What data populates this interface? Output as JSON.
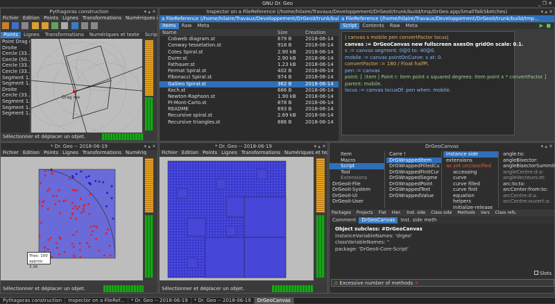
{
  "topbar": {
    "title": "GNU Dr. Geo",
    "controls": "_ ❐ ✕"
  },
  "pyth": {
    "title": "Pythagoras construction",
    "menu": [
      "Fichier",
      "Édition",
      "Points",
      "Lignes",
      "Transformations",
      "Numériques et tex"
    ],
    "tabs": [
      "Points",
      "Lignes",
      "Transformations",
      "Numériques et texte",
      "Script"
    ],
    "items": [
      "Point Drag me",
      "Droite",
      "Cercle (33..",
      "Cercle (50..",
      "Cercle (33..",
      "Cercle (33..",
      "Segment 1..",
      "Segment 1..",
      "Droite",
      "Cercle (33..",
      "Segment 1..",
      "Segment 1..",
      "Segment 1.."
    ],
    "drag": "Drag me",
    "status": "Sélectionner et déplacer un objet."
  },
  "inspector": {
    "title": "Inspector on a FileReference (/home/hilaire/Travaux/Developpement/DrGeoII/trunk/build/tmp/DrGeo.app/SmallTalkSketches)",
    "path_left": "a FileReference (/home/hilaire/Travaux/Developpement/DrGeoII/trunk/build/tmp/DrGeo.app/...",
    "path_right": "a FileReference (/home/hilaire/Travaux/Developpement/DrGeoII/trunk/build/tmp...",
    "tabs_left": [
      "Items",
      "Raw",
      "Meta"
    ],
    "tabs_right": [
      "Script",
      "Contents",
      "Raw",
      "Meta"
    ],
    "headers": [
      "Name",
      "Size",
      "Creation"
    ],
    "files": [
      [
        "Cobweb diagram.st",
        "679 B",
        "2018-06-14"
      ],
      [
        "Conway tesselation.st",
        "918 B",
        "2018-06-14"
      ],
      [
        "Cotes Spiral.st",
        "2.90 kB",
        "2018-06-14"
      ],
      [
        "Durer.st",
        "2.90 kB",
        "2018-06-14"
      ],
      [
        "Fathauer.st",
        "1.23 kB",
        "2018-06-14"
      ],
      [
        "Fermat Spiral.st",
        "402 B",
        "2018-06-14"
      ],
      [
        "Fibonacci Spiral.st",
        "974 B",
        "2018-06-14"
      ],
      [
        "Galileo Spiral.st",
        "362 B",
        "2018-06-14"
      ],
      [
        "Koch.st",
        "666 B",
        "2018-06-14"
      ],
      [
        "Newton-Raphson.st",
        "1.90 kB",
        "2018-06-14"
      ],
      [
        "PI-Mont-Carlo.st",
        "878 B",
        "2018-06-14"
      ],
      [
        "README",
        "693 B",
        "2018-06-14"
      ],
      [
        "Recursive spiral.st",
        "2.69 kB",
        "2018-06-14"
      ],
      [
        "Recursive triangles.st",
        "886 B",
        "2018-06-14"
      ]
    ],
    "selected_index": 7,
    "code": [
      "| canvas s mobile pen convertFactor locus|",
      "canvas := DrGeoCanvas new fullscreen axesOn gridOn scale: 0.1.",
      "s := canvas segment: 0@0 to: 40@0.",
      "mobile := canvas pointOnCurve: s at: 0.",
      "convertFactor := 180 / Float halfPi.",
      "pen := canvas",
      "    point: [ :item | Point r: item point x squared  degrees: item point x * convertFactor ]",
      "    parent: mobile.",
      "locus := canvas locusOf: pen when: mobile."
    ]
  },
  "dg1": {
    "title": "* Dr. Geo -- 2018-06-19",
    "menu": [
      "Fichier",
      "Édition",
      "Points",
      "Lignes",
      "Transformations",
      "Numériq"
    ],
    "tries": "Tries: 100",
    "approx": "approx: 3.36",
    "status": "Sélectionner et déplacer un objet."
  },
  "dg2": {
    "title": "* Dr. Geo -- 2018-06-19",
    "menu": [
      "Fichier",
      "Édition",
      "Points",
      "Lignes",
      "Transformations",
      "Numériques et texte"
    ],
    "status": "Sélectionner et déplacer un objet."
  },
  "browser": {
    "title": "DrGeoCanvas",
    "packages": [
      "Item",
      "Macro",
      "Script",
      "Tool",
      "Extensions",
      "DrGeoII-File",
      "DrGeoII-System",
      "DrGeoII-UI",
      "DrGeoII-User"
    ],
    "classes": [
      "Carre !",
      "DrGWrappedItem",
      "DrGWrappedFilledCu",
      "DrGWrappedFinitCur",
      "DrGWrappedSegme",
      "DrGWrappedPoint",
      "DrGWrappedText",
      "DrGWrappedValue"
    ],
    "protocols": [
      "instance side",
      "extensions",
      "as yet unclassified",
      "accessing",
      "curve",
      "curve filled",
      "curve finit",
      "equation",
      "helpers",
      "initialize-release"
    ],
    "methods": [
      "angle:to:",
      "angleBisector:",
      "angleBisectorSummit:sid",
      "angleCentre:d:a:",
      "angleVecteurs:et:",
      "arc:to:to:",
      "arcCenter:from:to:",
      "arcCentre:d:a:",
      "arcCentre:ouvert:a:"
    ],
    "toolbar": [
      "Packages",
      "Projects",
      "Flat",
      "Hier.",
      "Inst. side",
      "Class side",
      "Methods",
      "Vars",
      "Class refs."
    ],
    "tabs": [
      "Comment",
      "DrGeoCanvas",
      "Inst. side meth"
    ],
    "source": [
      "Object subclass: #DrGeoCanvas",
      "    instanceVariableNames: 'drgeo'",
      "    classVariableNames: ''",
      "    package: 'DrGeoII-Core-Script'"
    ],
    "slots": "Slots",
    "warning": "Excessive number of methods"
  },
  "taskbar": [
    "Pythagoras construction",
    "Inspector on a FileRef...",
    "* Dr. Geo -- 2018-06-19",
    "* Dr. Geo -- 2018-06-19",
    "DrGeoCanvas"
  ],
  "colors": {
    "accent": "#2f6fb8",
    "green": "#1aa41a",
    "orange": "#e09a1a"
  }
}
